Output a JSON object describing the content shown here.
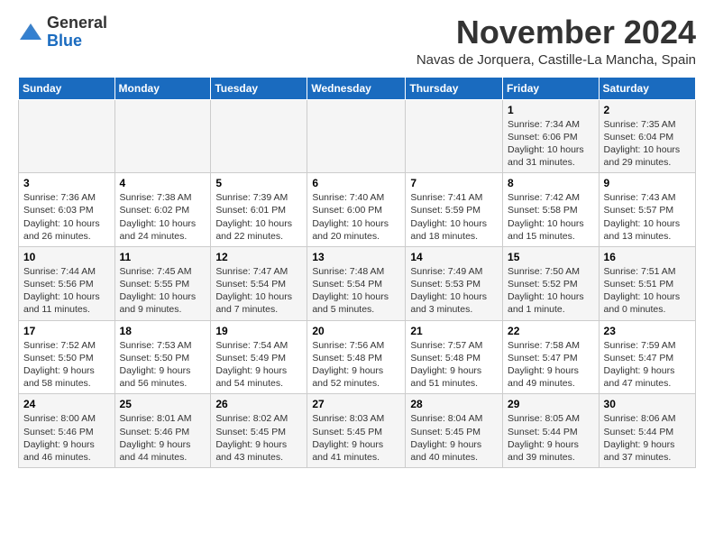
{
  "logo": {
    "general": "General",
    "blue": "Blue"
  },
  "header": {
    "month": "November 2024",
    "location": "Navas de Jorquera, Castille-La Mancha, Spain"
  },
  "weekdays": [
    "Sunday",
    "Monday",
    "Tuesday",
    "Wednesday",
    "Thursday",
    "Friday",
    "Saturday"
  ],
  "weeks": [
    [
      {
        "day": "",
        "info": ""
      },
      {
        "day": "",
        "info": ""
      },
      {
        "day": "",
        "info": ""
      },
      {
        "day": "",
        "info": ""
      },
      {
        "day": "",
        "info": ""
      },
      {
        "day": "1",
        "info": "Sunrise: 7:34 AM\nSunset: 6:06 PM\nDaylight: 10 hours and 31 minutes."
      },
      {
        "day": "2",
        "info": "Sunrise: 7:35 AM\nSunset: 6:04 PM\nDaylight: 10 hours and 29 minutes."
      }
    ],
    [
      {
        "day": "3",
        "info": "Sunrise: 7:36 AM\nSunset: 6:03 PM\nDaylight: 10 hours and 26 minutes."
      },
      {
        "day": "4",
        "info": "Sunrise: 7:38 AM\nSunset: 6:02 PM\nDaylight: 10 hours and 24 minutes."
      },
      {
        "day": "5",
        "info": "Sunrise: 7:39 AM\nSunset: 6:01 PM\nDaylight: 10 hours and 22 minutes."
      },
      {
        "day": "6",
        "info": "Sunrise: 7:40 AM\nSunset: 6:00 PM\nDaylight: 10 hours and 20 minutes."
      },
      {
        "day": "7",
        "info": "Sunrise: 7:41 AM\nSunset: 5:59 PM\nDaylight: 10 hours and 18 minutes."
      },
      {
        "day": "8",
        "info": "Sunrise: 7:42 AM\nSunset: 5:58 PM\nDaylight: 10 hours and 15 minutes."
      },
      {
        "day": "9",
        "info": "Sunrise: 7:43 AM\nSunset: 5:57 PM\nDaylight: 10 hours and 13 minutes."
      }
    ],
    [
      {
        "day": "10",
        "info": "Sunrise: 7:44 AM\nSunset: 5:56 PM\nDaylight: 10 hours and 11 minutes."
      },
      {
        "day": "11",
        "info": "Sunrise: 7:45 AM\nSunset: 5:55 PM\nDaylight: 10 hours and 9 minutes."
      },
      {
        "day": "12",
        "info": "Sunrise: 7:47 AM\nSunset: 5:54 PM\nDaylight: 10 hours and 7 minutes."
      },
      {
        "day": "13",
        "info": "Sunrise: 7:48 AM\nSunset: 5:54 PM\nDaylight: 10 hours and 5 minutes."
      },
      {
        "day": "14",
        "info": "Sunrise: 7:49 AM\nSunset: 5:53 PM\nDaylight: 10 hours and 3 minutes."
      },
      {
        "day": "15",
        "info": "Sunrise: 7:50 AM\nSunset: 5:52 PM\nDaylight: 10 hours and 1 minute."
      },
      {
        "day": "16",
        "info": "Sunrise: 7:51 AM\nSunset: 5:51 PM\nDaylight: 10 hours and 0 minutes."
      }
    ],
    [
      {
        "day": "17",
        "info": "Sunrise: 7:52 AM\nSunset: 5:50 PM\nDaylight: 9 hours and 58 minutes."
      },
      {
        "day": "18",
        "info": "Sunrise: 7:53 AM\nSunset: 5:50 PM\nDaylight: 9 hours and 56 minutes."
      },
      {
        "day": "19",
        "info": "Sunrise: 7:54 AM\nSunset: 5:49 PM\nDaylight: 9 hours and 54 minutes."
      },
      {
        "day": "20",
        "info": "Sunrise: 7:56 AM\nSunset: 5:48 PM\nDaylight: 9 hours and 52 minutes."
      },
      {
        "day": "21",
        "info": "Sunrise: 7:57 AM\nSunset: 5:48 PM\nDaylight: 9 hours and 51 minutes."
      },
      {
        "day": "22",
        "info": "Sunrise: 7:58 AM\nSunset: 5:47 PM\nDaylight: 9 hours and 49 minutes."
      },
      {
        "day": "23",
        "info": "Sunrise: 7:59 AM\nSunset: 5:47 PM\nDaylight: 9 hours and 47 minutes."
      }
    ],
    [
      {
        "day": "24",
        "info": "Sunrise: 8:00 AM\nSunset: 5:46 PM\nDaylight: 9 hours and 46 minutes."
      },
      {
        "day": "25",
        "info": "Sunrise: 8:01 AM\nSunset: 5:46 PM\nDaylight: 9 hours and 44 minutes."
      },
      {
        "day": "26",
        "info": "Sunrise: 8:02 AM\nSunset: 5:45 PM\nDaylight: 9 hours and 43 minutes."
      },
      {
        "day": "27",
        "info": "Sunrise: 8:03 AM\nSunset: 5:45 PM\nDaylight: 9 hours and 41 minutes."
      },
      {
        "day": "28",
        "info": "Sunrise: 8:04 AM\nSunset: 5:45 PM\nDaylight: 9 hours and 40 minutes."
      },
      {
        "day": "29",
        "info": "Sunrise: 8:05 AM\nSunset: 5:44 PM\nDaylight: 9 hours and 39 minutes."
      },
      {
        "day": "30",
        "info": "Sunrise: 8:06 AM\nSunset: 5:44 PM\nDaylight: 9 hours and 37 minutes."
      }
    ]
  ]
}
